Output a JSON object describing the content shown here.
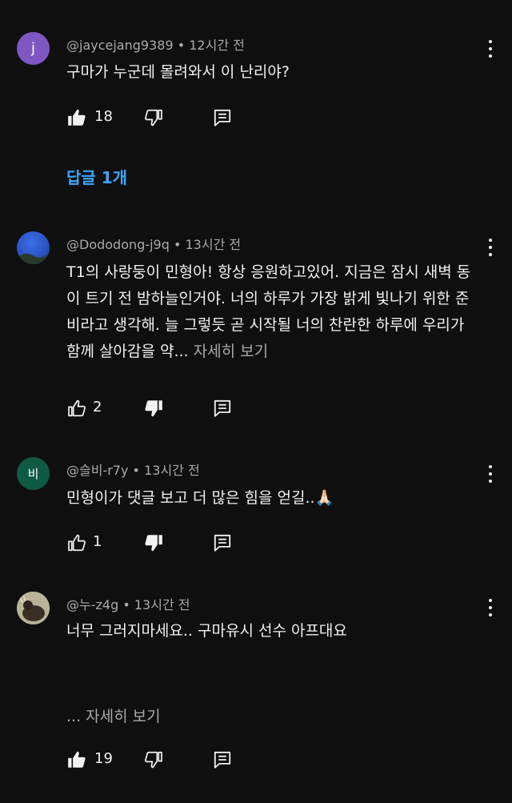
{
  "comments": [
    {
      "author": "@jaycejang9389",
      "time": "12시간 전",
      "avatar_letter": "j",
      "avatar_color": "#7e57c2",
      "text": "구마가 누군데 몰려와서 이 난리야?",
      "likes": "18",
      "liked": true,
      "disliked": false,
      "replies_label": "답글 1개"
    },
    {
      "author": "@Dododong-j9q",
      "time": "13시간 전",
      "avatar_letter": "",
      "avatar_color": "#2f5fd3",
      "text": "T1의 사랑둥이 민형아! 항상 응원하고있어. 지금은 잠시 새벽 동이 트기 전 밤하늘인거야. 너의 하루가 가장 밝게 빛나기 위한 준비라고 생각해. 늘 그렇듯 곧 시작될 너의 찬란한 하루에 우리가 함께 살아감을 약...",
      "more_label": "자세히 보기",
      "likes": "2",
      "liked": false,
      "disliked": true
    },
    {
      "author": "@슬비-r7y",
      "time": "13시간 전",
      "avatar_letter": "비",
      "avatar_color": "#0f5a43",
      "text": "민형이가 댓글 보고 더 많은 힘을 얻길..🙏🏻",
      "likes": "1",
      "liked": false,
      "disliked": true
    },
    {
      "author": "@누-z4g",
      "time": "13시간 전",
      "avatar_letter": "",
      "avatar_color": "#8a7d55",
      "text": "너무 그러지마세요.. 구마유시 선수 아프대요",
      "more_label": "... 자세히 보기",
      "likes": "19",
      "liked": true,
      "disliked": false
    }
  ],
  "meta_separator": "•",
  "icons": {
    "like": "thumbs-up-icon",
    "dislike": "thumbs-down-icon",
    "reply": "reply-icon",
    "menu": "more-vert-icon"
  }
}
